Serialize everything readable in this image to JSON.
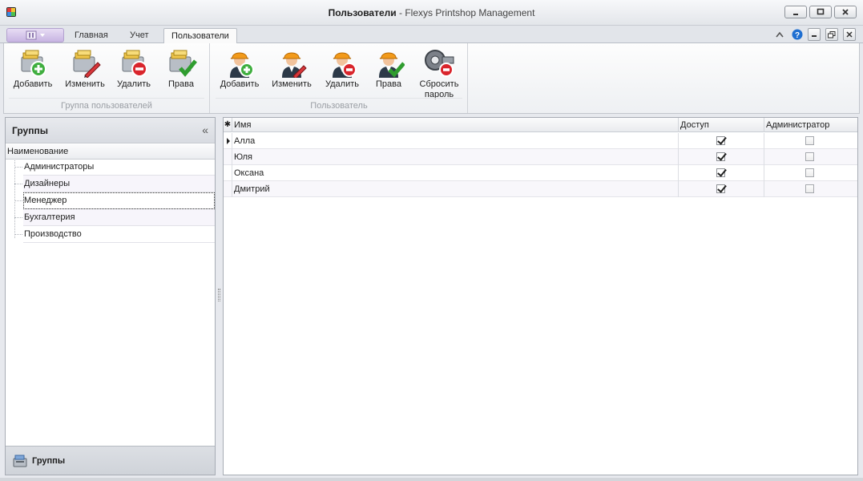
{
  "window": {
    "title_bold": "Пользователи",
    "title_rest": " - Flexys Printshop Management"
  },
  "tabs": [
    "Главная",
    "Учет",
    "Пользователи"
  ],
  "ribbon": {
    "group_users_group": {
      "label": "Группа пользователей",
      "buttons": [
        "Добавить",
        "Изменить",
        "Удалить",
        "Права"
      ]
    },
    "group_user": {
      "label": "Пользователь",
      "buttons": [
        "Добавить",
        "Изменить",
        "Удалить",
        "Права"
      ],
      "reset_line1": "Сбросить",
      "reset_line2": "пароль"
    }
  },
  "groups_panel": {
    "title": "Группы",
    "column": "Наименование",
    "items": [
      "Администраторы",
      "Дизайнеры",
      "Менеджер",
      "Бухгалтерия",
      "Производство"
    ],
    "selected": "Менеджер",
    "nav_label": "Группы"
  },
  "users_grid": {
    "columns": [
      "Имя",
      "Доступ",
      "Администратор"
    ],
    "rows": [
      {
        "name": "Алла",
        "access": true,
        "admin": false
      },
      {
        "name": "Юля",
        "access": true,
        "admin": false
      },
      {
        "name": "Оксана",
        "access": true,
        "admin": false
      },
      {
        "name": "Дмитрий",
        "access": true,
        "admin": false
      }
    ]
  }
}
